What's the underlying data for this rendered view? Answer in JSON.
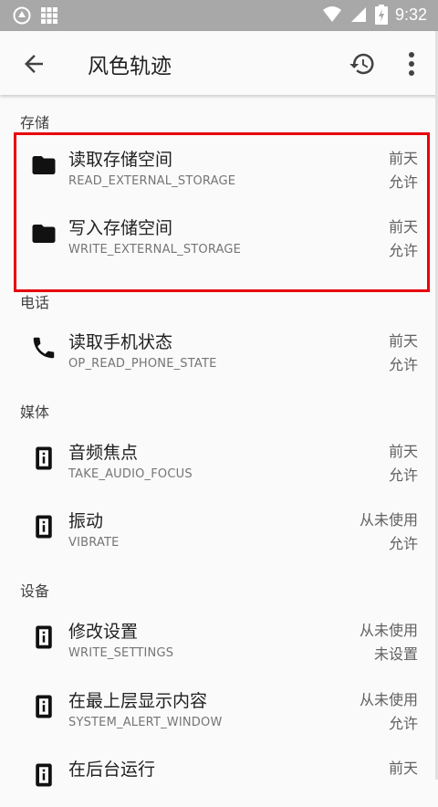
{
  "status_bar": {
    "time": "9:32"
  },
  "app_bar": {
    "title": "风色轨迹"
  },
  "sections": {
    "storage": "存储",
    "phone": "电话",
    "media": "媒体",
    "device": "设备"
  },
  "items": [
    {
      "name": "读取存储空间",
      "code": "READ_EXTERNAL_STORAGE",
      "time": "前天",
      "status": "允许",
      "icon": "folder-icon"
    },
    {
      "name": "写入存储空间",
      "code": "WRITE_EXTERNAL_STORAGE",
      "time": "前天",
      "status": "允许",
      "icon": "folder-icon"
    },
    {
      "name": "读取手机状态",
      "code": "OP_READ_PHONE_STATE",
      "time": "前天",
      "status": "允许",
      "icon": "phone-icon"
    },
    {
      "name": "音频焦点",
      "code": "TAKE_AUDIO_FOCUS",
      "time": "前天",
      "status": "允许",
      "icon": "info-icon"
    },
    {
      "name": "振动",
      "code": "VIBRATE",
      "time": "从未使用",
      "status": "允许",
      "icon": "info-icon"
    },
    {
      "name": "修改设置",
      "code": "WRITE_SETTINGS",
      "time": "从未使用",
      "status": "未设置",
      "icon": "info-icon"
    },
    {
      "name": "在最上层显示内容",
      "code": "SYSTEM_ALERT_WINDOW",
      "time": "从未使用",
      "status": "允许",
      "icon": "info-icon"
    },
    {
      "name": "在后台运行",
      "code": "",
      "time": "前天",
      "status": "",
      "icon": "info-icon"
    }
  ],
  "colors": {
    "highlight": "#e8000b",
    "status_bar": "#a8a8a8"
  }
}
